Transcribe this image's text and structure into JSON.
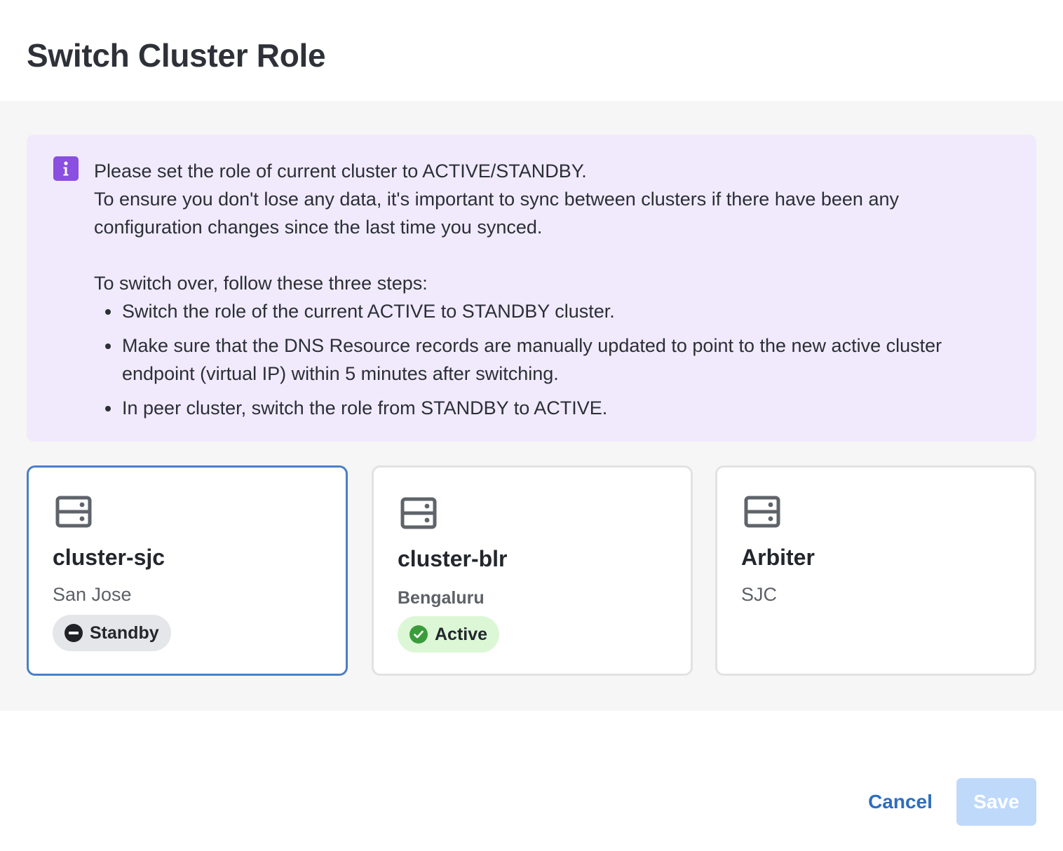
{
  "dialog": {
    "title": "Switch Cluster Role"
  },
  "info": {
    "icon": "info-icon",
    "accent": "#8a4fe0",
    "line1": "Please set the role of current cluster to ACTIVE/STANDBY.",
    "line2": "To ensure you don't lose any data, it's important to sync between clusters if there have been any configuration changes since the last time you synced.",
    "steps_intro": "To switch over, follow these three steps:",
    "steps": [
      "Switch the role of the current ACTIVE to STANDBY cluster.",
      "Make sure that the DNS Resource records are manually updated to point to the new active cluster endpoint (virtual IP) within 5 minutes after switching.",
      "In peer cluster, switch the role from STANDBY to ACTIVE."
    ]
  },
  "clusters": [
    {
      "name": "cluster-sjc",
      "location": "San Jose",
      "status": "Standby",
      "status_icon": "minus-circle-icon",
      "selected": true
    },
    {
      "name": "cluster-blr",
      "location": "Bengaluru",
      "status": "Active",
      "status_icon": "check-circle-icon",
      "selected": false
    },
    {
      "name": "Arbiter",
      "location": "SJC",
      "selected": false
    }
  ],
  "footer": {
    "cancel_label": "Cancel",
    "save_label": "Save"
  },
  "colors": {
    "selected_border": "#4a80c4",
    "active_badge": "#dcf7d6",
    "standby_badge": "#e4e6e9",
    "primary_link": "#2d6ec0",
    "save_disabled": "#bfd9fb"
  }
}
